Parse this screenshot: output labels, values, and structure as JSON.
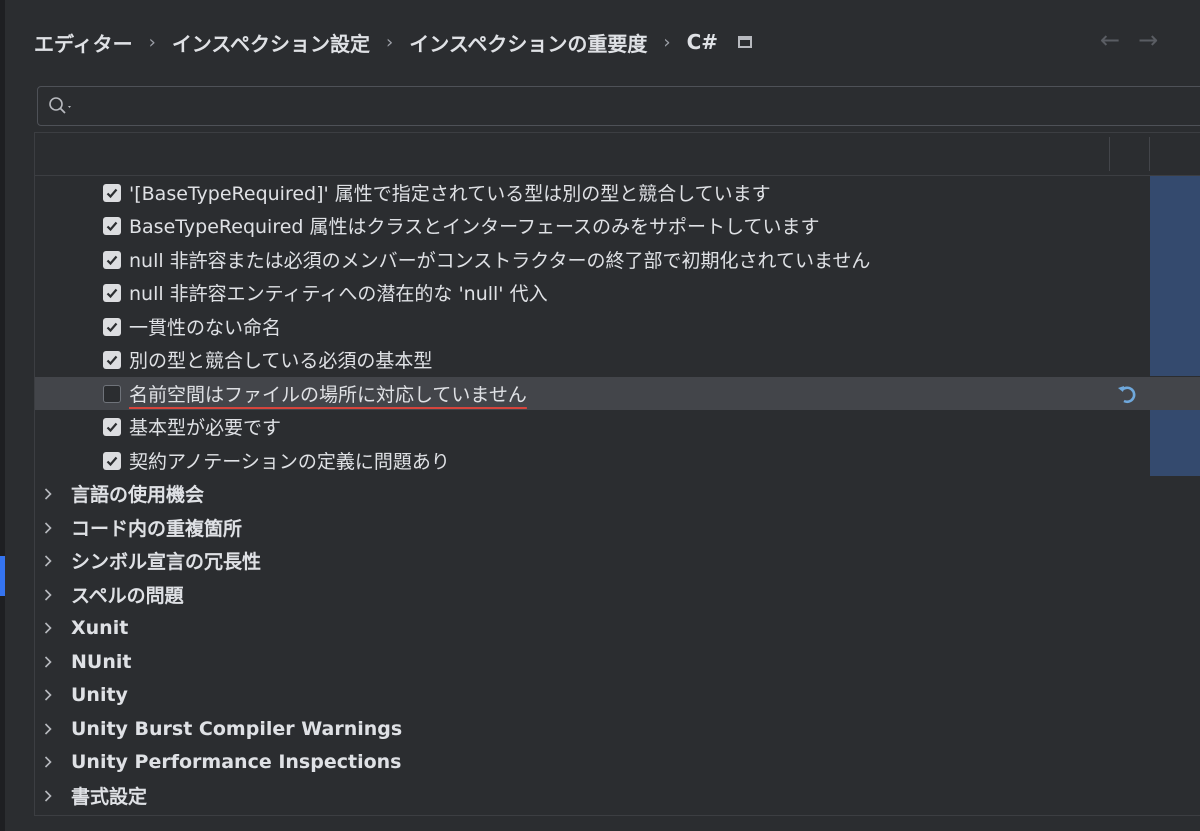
{
  "breadcrumb": {
    "items": [
      "エディター",
      "インスペクション設定",
      "インスペクションの重要度",
      "C#"
    ],
    "separator": "›"
  },
  "nav": {
    "back": "←",
    "forward": "→"
  },
  "search": {
    "value": "",
    "placeholder": ""
  },
  "inspections": [
    {
      "label": "'[BaseTypeRequired]' 属性で指定されている型は別の型と競合しています",
      "checked": true
    },
    {
      "label": "BaseTypeRequired 属性はクラスとインターフェースのみをサポートしています",
      "checked": true
    },
    {
      "label": "null 非許容または必須のメンバーがコンストラクターの終了部で初期化されていません",
      "checked": true
    },
    {
      "label": "null 非許容エンティティへの潜在的な 'null' 代入",
      "checked": true
    },
    {
      "label": "一貫性のない命名",
      "checked": true
    },
    {
      "label": "別の型と競合している必須の基本型",
      "checked": true
    },
    {
      "label": "名前空間はファイルの場所に対応していません",
      "checked": false,
      "selected": true
    },
    {
      "label": "基本型が必要です",
      "checked": true
    },
    {
      "label": "契約アノテーションの定義に問題あり",
      "checked": true
    }
  ],
  "groups": [
    {
      "label": "言語の使用機会"
    },
    {
      "label": "コード内の重複箇所"
    },
    {
      "label": "シンボル宣言の冗長性"
    },
    {
      "label": "スペルの問題"
    },
    {
      "label": "Xunit"
    },
    {
      "label": "NUnit"
    },
    {
      "label": "Unity"
    },
    {
      "label": "Unity Burst Compiler Warnings"
    },
    {
      "label": "Unity Performance Inspections"
    },
    {
      "label": "書式設定"
    }
  ],
  "colors": {
    "background": "#2b2d30",
    "selected_row": "#43454a",
    "severity_column": "#344a6e",
    "error_underline": "#d6453d",
    "reset_icon": "#6fa8dc"
  },
  "icons": {
    "search": "search-icon",
    "window": "window-icon",
    "reset": "reset-icon",
    "checkbox": "check-icon",
    "expand": "chevron-right-icon"
  }
}
